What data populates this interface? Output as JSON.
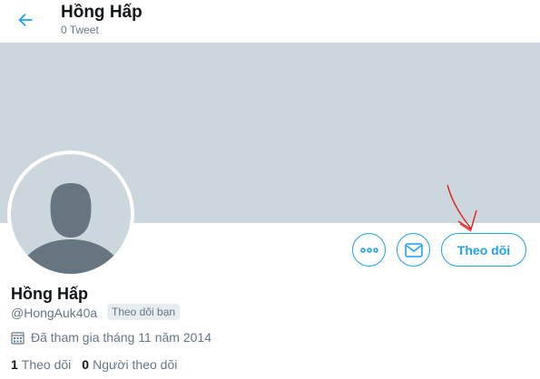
{
  "header": {
    "name": "Hồng Hấp",
    "tweet_count": "0 Tweet"
  },
  "profile": {
    "name": "Hồng Hấp",
    "handle": "@HongAuk40a",
    "follows_you_badge": "Theo dõi bạn",
    "joined": "Đã tham gia tháng 11 năm 2014"
  },
  "actions": {
    "follow_label": "Theo dõi"
  },
  "stats": {
    "following_count": "1",
    "following_label": "Theo dõi",
    "followers_count": "0",
    "followers_label": "Người theo dõi"
  },
  "icons": {
    "back": "arrow-left-icon",
    "more": "more-dots-icon",
    "message": "envelope-icon",
    "calendar": "calendar-icon"
  },
  "colors": {
    "accent": "#1da1f2",
    "banner": "#ccd6dd",
    "avatar_silhouette": "#66757f",
    "annotation": "#e0201a"
  }
}
